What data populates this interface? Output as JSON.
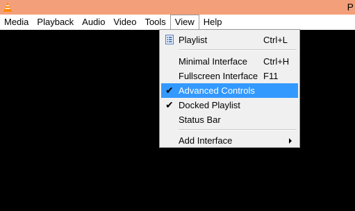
{
  "window": {
    "title_visible": "P"
  },
  "menubar": {
    "items": [
      {
        "label": "Media"
      },
      {
        "label": "Playback"
      },
      {
        "label": "Audio"
      },
      {
        "label": "Video"
      },
      {
        "label": "Tools"
      },
      {
        "label": "View"
      },
      {
        "label": "Help"
      }
    ],
    "open_menu": "View"
  },
  "view_menu": {
    "items": [
      {
        "label": "Playlist",
        "shortcut": "Ctrl+L",
        "icon": "playlist-icon"
      },
      {
        "label": "Minimal Interface",
        "shortcut": "Ctrl+H"
      },
      {
        "label": "Fullscreen Interface",
        "shortcut": "F11"
      },
      {
        "label": "Advanced Controls",
        "checked": true,
        "highlighted": true
      },
      {
        "label": "Docked Playlist",
        "checked": true
      },
      {
        "label": "Status Bar"
      },
      {
        "label": "Add Interface",
        "has_submenu": true
      }
    ],
    "check_glyph": "✔"
  },
  "colors": {
    "titlebar": "#f3a07a",
    "highlight": "#3399ff",
    "menu_bg": "#f0f0f0",
    "video_area": "#000000"
  }
}
